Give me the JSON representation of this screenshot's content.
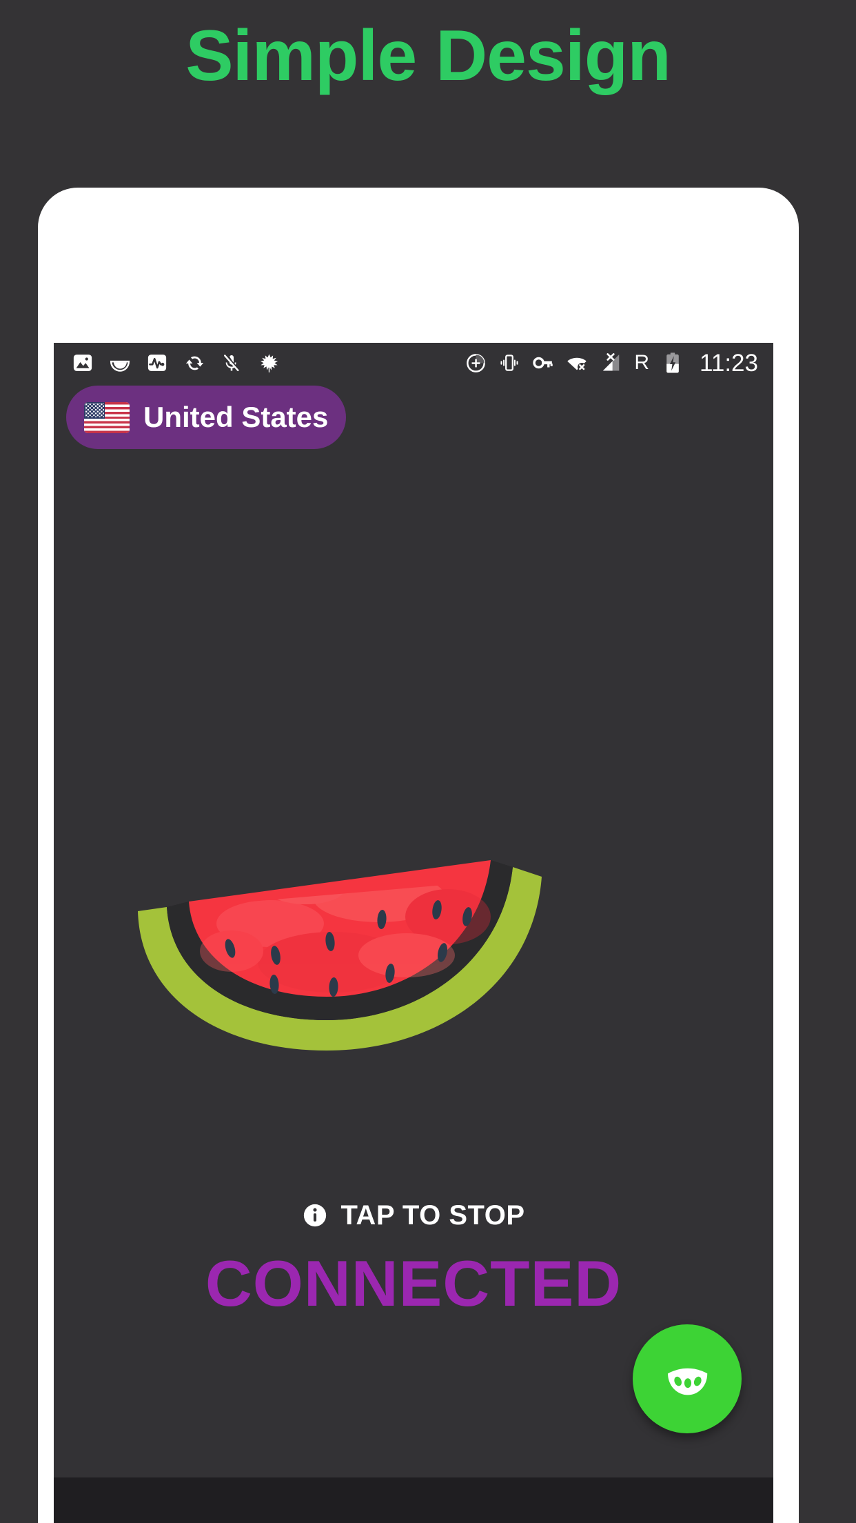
{
  "promo": {
    "headline": "Simple Design",
    "headline_color": "#2ECC63",
    "background_color": "#343335"
  },
  "phone": {
    "frame_color": "#FFFFFF",
    "screen_background": "#333235",
    "nav_bar_color": "#1F1E21"
  },
  "status_bar": {
    "left_icons": [
      {
        "name": "photo-icon",
        "label": "Screenshot"
      },
      {
        "name": "watermelon-slice-icon",
        "label": "VPN app"
      },
      {
        "name": "activity-pulse-icon",
        "label": "Monitor"
      },
      {
        "name": "sync-icon",
        "label": "Sync"
      },
      {
        "name": "microphone-muted-icon",
        "label": "Mic muted"
      },
      {
        "name": "leaf-icon",
        "label": "Battery saver"
      }
    ],
    "right_icons": [
      {
        "name": "do-not-disturb-icon",
        "label": "Do not disturb"
      },
      {
        "name": "vibrate-icon",
        "label": "Vibrate"
      },
      {
        "name": "vpn-key-icon",
        "label": "VPN"
      },
      {
        "name": "wifi-off-icon",
        "label": "Wi-Fi disconnected"
      },
      {
        "name": "signal-no-service-icon",
        "label": "No signal"
      }
    ],
    "roaming": "R",
    "battery": {
      "name": "battery-charging-icon",
      "label": "Charging"
    },
    "clock": "11:23"
  },
  "country_selector": {
    "flag_name": "us-flag-icon",
    "country": "United States",
    "pill_color": "#6C3080",
    "text_color": "#FFFFFF"
  },
  "hero": {
    "graphic_name": "watermelon-slice-illustration",
    "flesh_color": "#F53540",
    "rind_inner_color": "#2A2A2C",
    "rind_outer_color": "#A4C23A",
    "seed_color": "#2B3A4A",
    "seed_count": 10
  },
  "action": {
    "info_icon_name": "info-circle-icon",
    "tap_label": "TAP TO STOP",
    "tap_label_color": "#FFFFFF",
    "state_label": "CONNECTED",
    "state_color": "#9B27B0"
  },
  "fab": {
    "icon_name": "watermelon-slice-icon",
    "background_color": "#3DD335",
    "icon_color": "#FFFFFF"
  }
}
